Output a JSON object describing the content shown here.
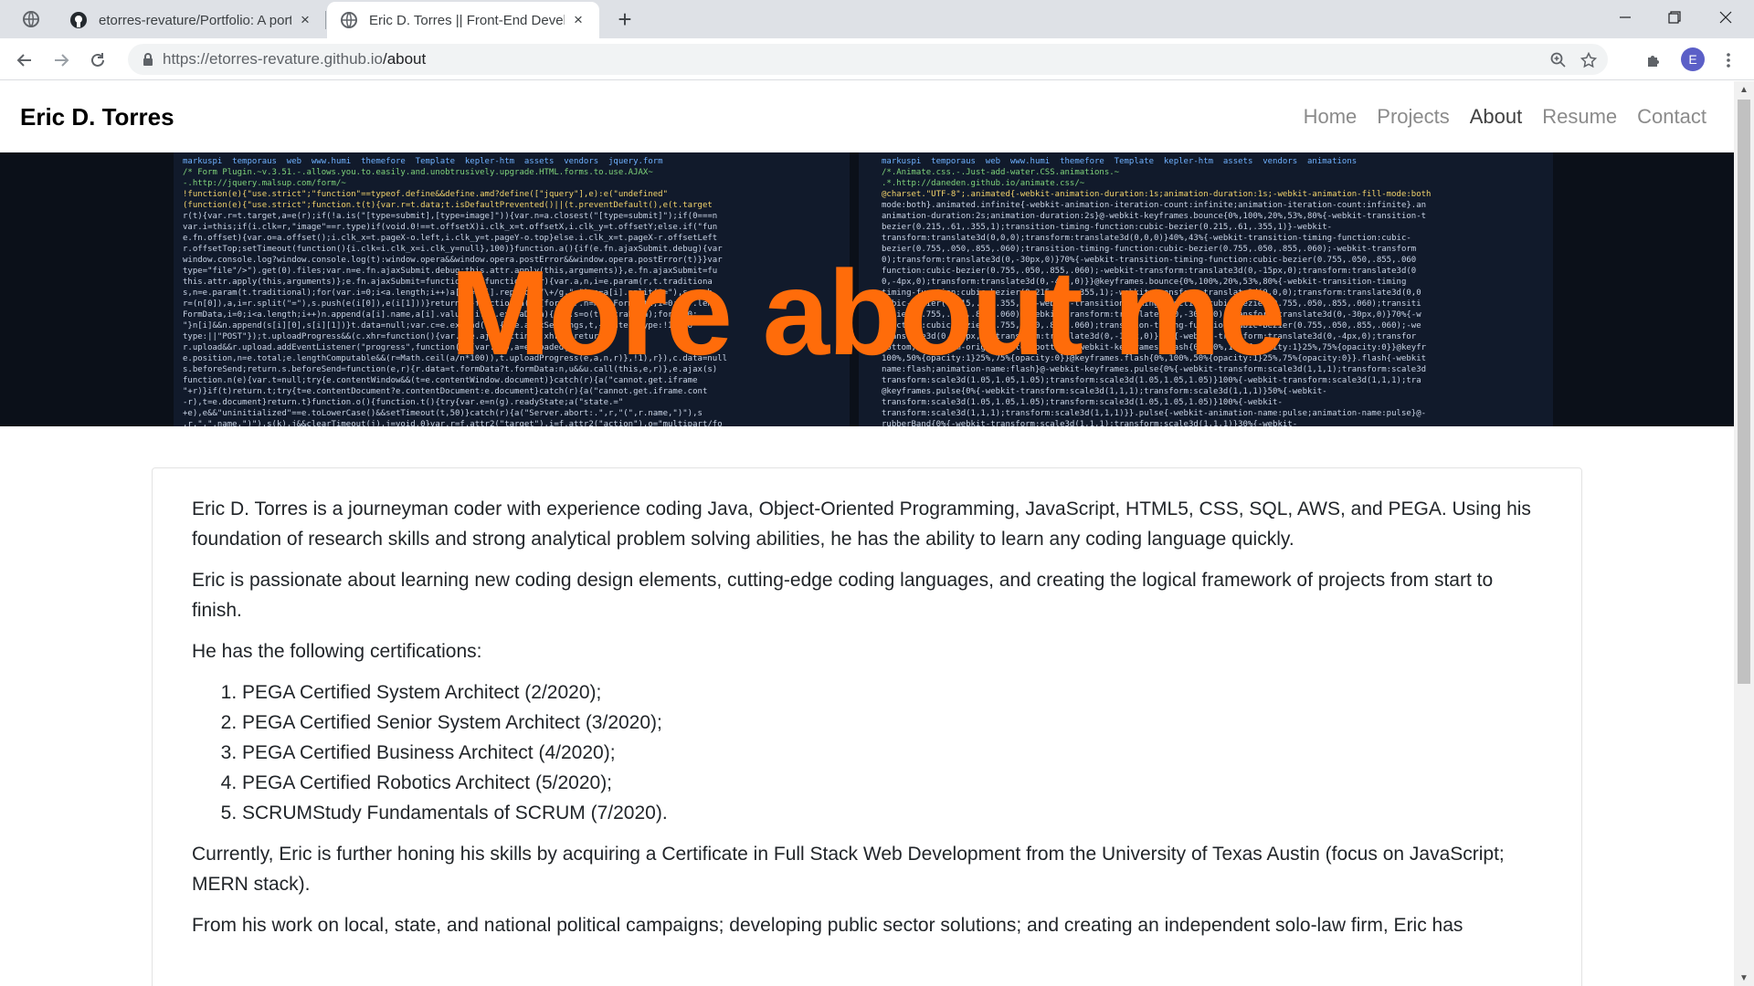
{
  "browser": {
    "tabs": [
      {
        "title": "etorres-revature/Portfolio: A port",
        "close": "×"
      },
      {
        "title": "Eric D. Torres || Front-End Develo",
        "close": "×"
      }
    ],
    "new_tab": "+",
    "url_host": "https://etorres-revature.github.io",
    "url_path": "/about",
    "profile_initial": "E"
  },
  "site": {
    "brand": "Eric D. Torres",
    "nav": [
      {
        "label": "Home",
        "active": false
      },
      {
        "label": "Projects",
        "active": false
      },
      {
        "label": "About",
        "active": true
      },
      {
        "label": "Resume",
        "active": false
      },
      {
        "label": "Contact",
        "active": false
      }
    ],
    "hero_title": "More about me"
  },
  "about": {
    "p1": "Eric D. Torres is a journeyman coder with experience coding Java, Object-Oriented Programming, JavaScript, HTML5, CSS, SQL, AWS, and PEGA. Using his foundation of research skills and strong analytical problem solving abilities, he has the ability to learn any coding language quickly.",
    "p2": "Eric is passionate about learning new coding design elements, cutting-edge coding languages, and creating the logical framework of projects from start to finish.",
    "p3": "He has the following certifications:",
    "certifications": [
      "PEGA Certified System Architect (2/2020);",
      "PEGA Certified Senior System Architect (3/2020);",
      "PEGA Certified Business Architect (4/2020);",
      "PEGA Certified Robotics Architect (5/2020);",
      "SCRUMStudy Fundamentals of SCRUM (7/2020)."
    ],
    "p4": "Currently, Eric is further honing his skills by acquiring a Certificate in Full Stack Web Development from the University of Texas Austin (focus on JavaScript; MERN stack).",
    "p5": "From his work on local, state, and national political campaigns; developing public sector solutions; and creating an independent solo-law firm, Eric has"
  },
  "colors": {
    "hero_title": "#ff6c0a",
    "tabbar": "#dee1e6",
    "profile": "#5b5fc7"
  }
}
